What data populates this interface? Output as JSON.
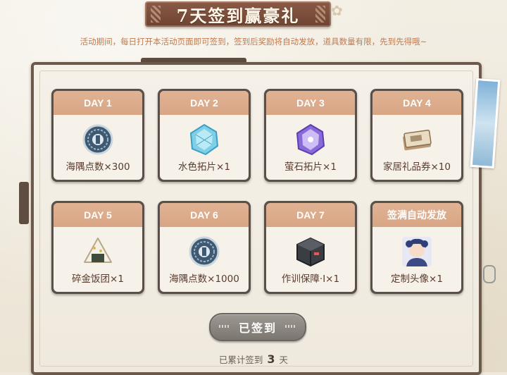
{
  "header": {
    "title": "7天签到赢豪礼",
    "subtitle": "活动期间，每日打开本活动页面即可签到，签到后奖励将自动发放，道具数量有限，先到先得哦~"
  },
  "rewards": [
    {
      "day_label": "DAY 1",
      "item": "海隅点数×300",
      "icon": "coin-icon",
      "status": "signed"
    },
    {
      "day_label": "DAY 2",
      "item": "水色拓片×1",
      "icon": "blue-crystal-icon",
      "status": "signed"
    },
    {
      "day_label": "DAY 3",
      "item": "萤石拓片×1",
      "icon": "purple-crystal-icon",
      "status": "signed"
    },
    {
      "day_label": "DAY 4",
      "item": "家居礼品券×10",
      "icon": "voucher-icon",
      "status": "locked"
    },
    {
      "day_label": "DAY 5",
      "item": "碎金饭团×1",
      "icon": "rice-ball-icon",
      "status": "locked"
    },
    {
      "day_label": "DAY 6",
      "item": "海隅点数×1000",
      "icon": "coin-icon",
      "status": "locked"
    },
    {
      "day_label": "DAY 7",
      "item": "作训保障·Ⅰ×1",
      "icon": "supply-box-icon",
      "status": "locked"
    },
    {
      "day_label": "签满自动发放",
      "item": "定制头像×1",
      "icon": "avatar-icon",
      "status": "locked"
    }
  ],
  "action": {
    "button_label": "已签到",
    "counter_prefix": "已累计签到",
    "counter_value": "3",
    "counter_suffix": "天"
  },
  "colors": {
    "card_header": "#d8a584",
    "title_banner": "#7a4e3c",
    "subtitle_text": "#c07a4e",
    "button_disabled": "#8c8681"
  }
}
